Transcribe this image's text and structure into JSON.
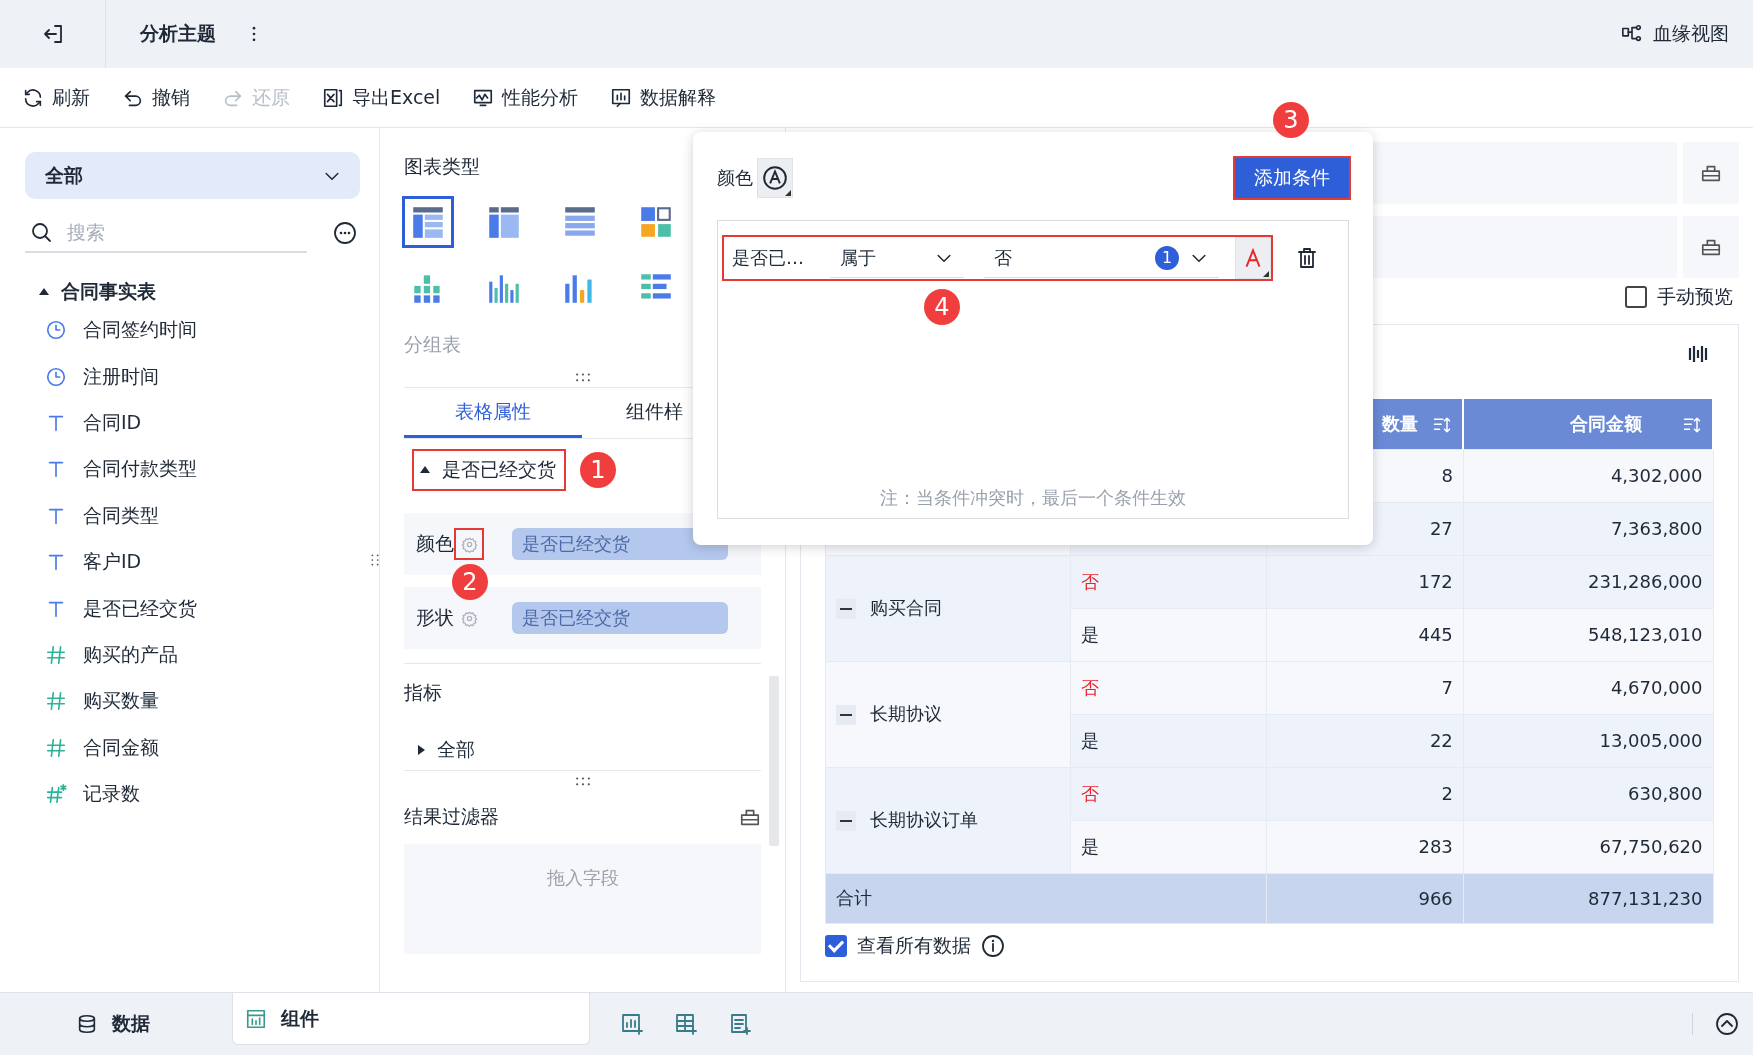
{
  "header": {
    "title": "分析主题",
    "lineage_label": "血缘视图"
  },
  "toolbar": [
    {
      "label": "刷新",
      "kind": "refresh",
      "disabled": false
    },
    {
      "label": "撤销",
      "kind": "undo",
      "disabled": false
    },
    {
      "label": "还原",
      "kind": "redo",
      "disabled": true
    },
    {
      "label": "导出Excel",
      "kind": "excel",
      "disabled": false
    },
    {
      "label": "性能分析",
      "kind": "performance",
      "disabled": false
    },
    {
      "label": "数据解释",
      "kind": "explain",
      "disabled": false
    }
  ],
  "data_panel": {
    "scope": "全部",
    "search_placeholder": "搜索",
    "table": {
      "name": "合同事实表",
      "expanded": true,
      "fields": [
        {
          "name": "合同签约时间",
          "kind": "time"
        },
        {
          "name": "注册时间",
          "kind": "time"
        },
        {
          "name": "合同ID",
          "kind": "text"
        },
        {
          "name": "合同付款类型",
          "kind": "text"
        },
        {
          "name": "合同类型",
          "kind": "text"
        },
        {
          "name": "客户ID",
          "kind": "text"
        },
        {
          "name": "是否已经交货",
          "kind": "text"
        },
        {
          "name": "购买的产品",
          "kind": "number"
        },
        {
          "name": "购买数量",
          "kind": "number"
        },
        {
          "name": "合同金额",
          "kind": "number"
        },
        {
          "name": "记录数",
          "kind": "calc"
        }
      ]
    }
  },
  "chart_types": {
    "title": "图表类型",
    "items": [
      {
        "kind": "group-table",
        "selected": true
      },
      {
        "kind": "cross-table",
        "selected": false
      },
      {
        "kind": "detail-table",
        "selected": false
      },
      {
        "kind": "tiles",
        "selected": false
      },
      {
        "kind": "stacked-columns",
        "selected": false
      },
      {
        "kind": "grouped-columns",
        "selected": false
      },
      {
        "kind": "columns",
        "selected": false
      },
      {
        "kind": "bars",
        "selected": false
      }
    ],
    "selected_name": "分组表"
  },
  "property_tabs": [
    {
      "label": "表格属性",
      "selected": true
    },
    {
      "label": "组件样",
      "selected": false
    }
  ],
  "dimension": {
    "label": "是否已经交货",
    "expanded": true,
    "highlighted": true,
    "callout": "1"
  },
  "encodings": [
    {
      "label": "颜色",
      "field": "是否已经交货",
      "highlighted": true,
      "callout": "2"
    },
    {
      "label": "形状",
      "field": "是否已经交货"
    }
  ],
  "metrics": {
    "title": "指标",
    "group": {
      "label": "全部",
      "expanded": false
    }
  },
  "result_filter": {
    "title": "结果过滤器",
    "placeholder": "拖入字段"
  },
  "color_popup": {
    "label": "颜色",
    "add_button": {
      "label": "添加条件",
      "highlighted": true,
      "callout": "3"
    },
    "conditions": [
      {
        "field": "是否已…",
        "operator": "属于",
        "value": "否",
        "count": "1",
        "color": "#e8262b",
        "highlighted": true,
        "callout": "4"
      }
    ],
    "note": "注：当条件冲突时，最后一个条件生效"
  },
  "preview": {
    "label": "手动预览",
    "checked": false
  },
  "table": {
    "columns": [
      {
        "label": "数量"
      },
      {
        "label": "合同金额"
      }
    ],
    "groups": [
      {
        "rows": [
          {
            "count": "8",
            "amount": "4,302,000"
          },
          {
            "count": "27",
            "amount": "7,363,800"
          }
        ]
      },
      {
        "name": "购买合同",
        "expanded": true,
        "rows": [
          {
            "flag": "否",
            "color": "#e8262b",
            "count": "172",
            "amount": "231,286,000"
          },
          {
            "flag": "是",
            "color": "#1f2937",
            "count": "445",
            "amount": "548,123,010"
          }
        ]
      },
      {
        "name": "长期协议",
        "expanded": true,
        "rows": [
          {
            "flag": "否",
            "color": "#e8262b",
            "count": "7",
            "amount": "4,670,000"
          },
          {
            "flag": "是",
            "color": "#1f2937",
            "count": "22",
            "amount": "13,005,000"
          }
        ]
      },
      {
        "name": "长期协议订单",
        "expanded": true,
        "rows": [
          {
            "flag": "否",
            "color": "#e8262b",
            "count": "2",
            "amount": "630,800"
          },
          {
            "flag": "是",
            "color": "#1f2937",
            "count": "283",
            "amount": "67,750,620"
          }
        ]
      }
    ],
    "total": {
      "label": "合计",
      "count": "966",
      "amount": "877,131,230"
    }
  },
  "show_all": {
    "label": "查看所有数据",
    "checked": true
  },
  "bottom_tabs": [
    {
      "label": "数据",
      "kind": "data",
      "selected": false
    },
    {
      "label": "组件",
      "kind": "component",
      "selected": true
    }
  ]
}
